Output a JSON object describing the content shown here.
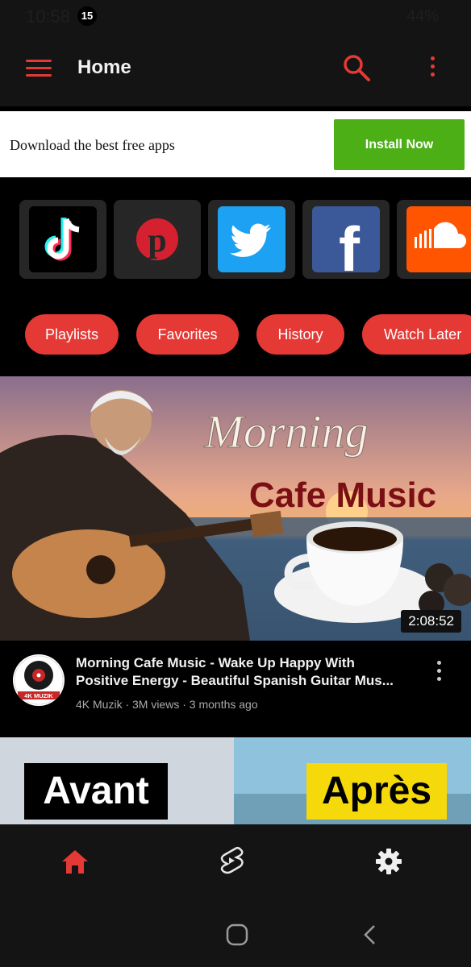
{
  "status_bar": {
    "time": "10:58",
    "notification_count": "15",
    "battery": "44%"
  },
  "header": {
    "title": "Home"
  },
  "ad": {
    "text": "Download the best free apps",
    "button_label": "Install Now"
  },
  "social_apps": [
    {
      "name": "TikTok",
      "icon": "tiktok-icon"
    },
    {
      "name": "Pinterest",
      "icon": "pinterest-icon"
    },
    {
      "name": "Twitter",
      "icon": "twitter-icon"
    },
    {
      "name": "Facebook",
      "icon": "facebook-icon"
    },
    {
      "name": "SoundCloud",
      "icon": "soundcloud-icon"
    }
  ],
  "chips": [
    "Playlists",
    "Favorites",
    "History",
    "Watch Later"
  ],
  "video": {
    "thumbnail_text_1": "Morning",
    "thumbnail_text_2": "Cafe Music",
    "duration": "2:08:52",
    "channel_logo_text": "4K MUZIK",
    "title_line_1": "Morning Cafe Music - Wake Up Happy With",
    "title_line_2": "Positive Energy - Beautiful Spanish Guitar Mus...",
    "meta": "4K Muzik · 3M views · 3 months ago"
  },
  "video2": {
    "left_label": "Avant",
    "right_label": "Après"
  },
  "bottom_nav": {
    "home": "home-icon",
    "shorts": "shorts-icon",
    "settings": "settings-icon"
  },
  "colors": {
    "accent": "#e53935",
    "install_button": "#4caf16",
    "background": "#000000"
  }
}
